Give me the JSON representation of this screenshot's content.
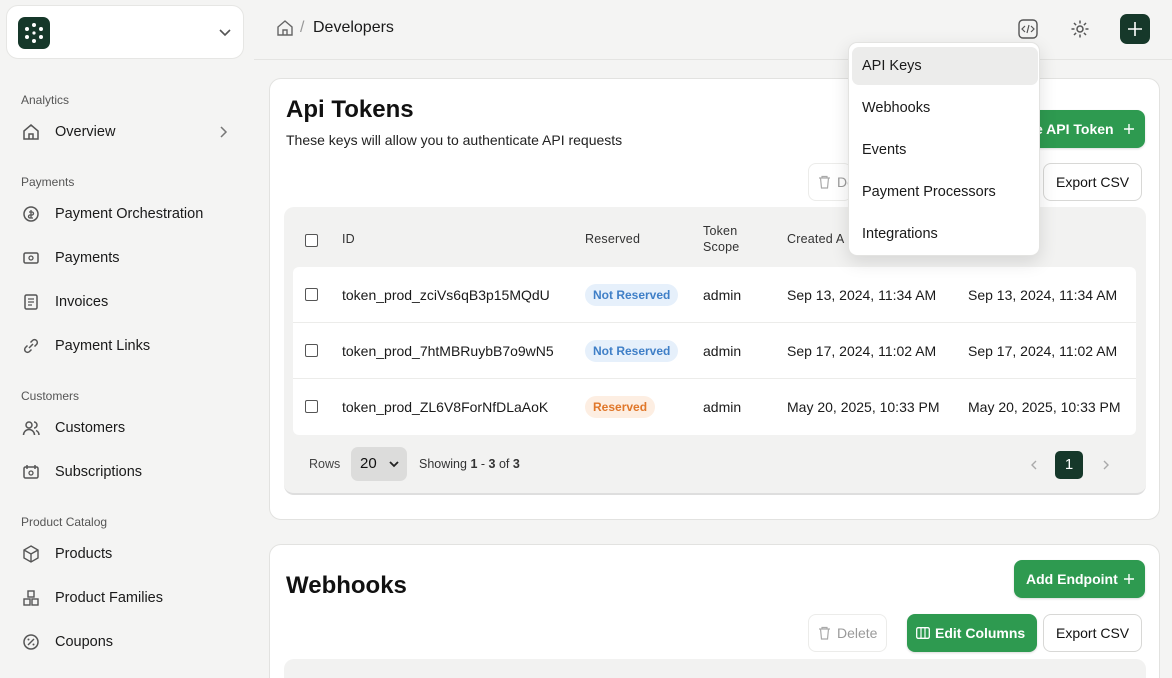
{
  "sidebar": {
    "sections": [
      {
        "label": "Analytics",
        "items": [
          {
            "label": "Overview",
            "icon": "home-icon"
          }
        ]
      },
      {
        "label": "Payments",
        "items": [
          {
            "label": "Payment Orchestration",
            "icon": "orchestration-icon"
          },
          {
            "label": "Payments",
            "icon": "cash-icon"
          },
          {
            "label": "Invoices",
            "icon": "invoice-icon"
          },
          {
            "label": "Payment Links",
            "icon": "link-icon"
          }
        ]
      },
      {
        "label": "Customers",
        "items": [
          {
            "label": "Customers",
            "icon": "users-icon"
          },
          {
            "label": "Subscriptions",
            "icon": "subscriptions-icon"
          }
        ]
      },
      {
        "label": "Product Catalog",
        "items": [
          {
            "label": "Products",
            "icon": "box-icon"
          },
          {
            "label": "Product Families",
            "icon": "boxes-icon"
          },
          {
            "label": "Coupons",
            "icon": "coupon-icon"
          }
        ]
      }
    ]
  },
  "header": {
    "breadcrumb": {
      "separator": "/",
      "current": "Developers"
    }
  },
  "api_tokens": {
    "title": "Api Tokens",
    "subtitle": "These keys will allow you to authenticate API requests",
    "create_button": "e API Token",
    "delete_button": "De",
    "export_button": "Export CSV",
    "columns": [
      "ID",
      "Reserved",
      "Token Scope",
      "Created A"
    ],
    "rows": [
      {
        "id": "token_prod_zciVs6qB3p15MQdU",
        "reserved": "Not Reserved",
        "scope": "admin",
        "created": "Sep 13, 2024, 11:34 AM",
        "updated": "Sep 13, 2024, 11:34 AM"
      },
      {
        "id": "token_prod_7htMBRuybB7o9wN5",
        "reserved": "Not Reserved",
        "scope": "admin",
        "created": "Sep 17, 2024, 11:02 AM",
        "updated": "Sep 17, 2024, 11:02 AM"
      },
      {
        "id": "token_prod_ZL6V8ForNfDLaAoK",
        "reserved": "Reserved",
        "scope": "admin",
        "created": "May 20, 2025, 10:33 PM",
        "updated": "May 20, 2025, 10:33 PM"
      }
    ],
    "pagination": {
      "rows_label": "Rows",
      "rows_value": "20",
      "showing_prefix": "Showing",
      "from": "1",
      "dash": "-",
      "to": "3",
      "of": "of",
      "total": "3",
      "page": "1"
    }
  },
  "webhooks": {
    "title": "Webhooks",
    "add_button": "Add Endpoint",
    "delete_button": "Delete",
    "edit_columns_button": "Edit Columns",
    "export_button": "Export CSV"
  },
  "dropdown": {
    "items": [
      "API Keys",
      "Webhooks",
      "Events",
      "Payment Processors",
      "Integrations"
    ],
    "active_index": 0
  },
  "colors": {
    "primary_green": "#2e9a50",
    "dark_green": "#16382a",
    "not_reserved_bg": "#e6f0fb",
    "not_reserved_text": "#3f7fc7",
    "reserved_bg": "#fdeee2",
    "reserved_text": "#e0772a"
  }
}
